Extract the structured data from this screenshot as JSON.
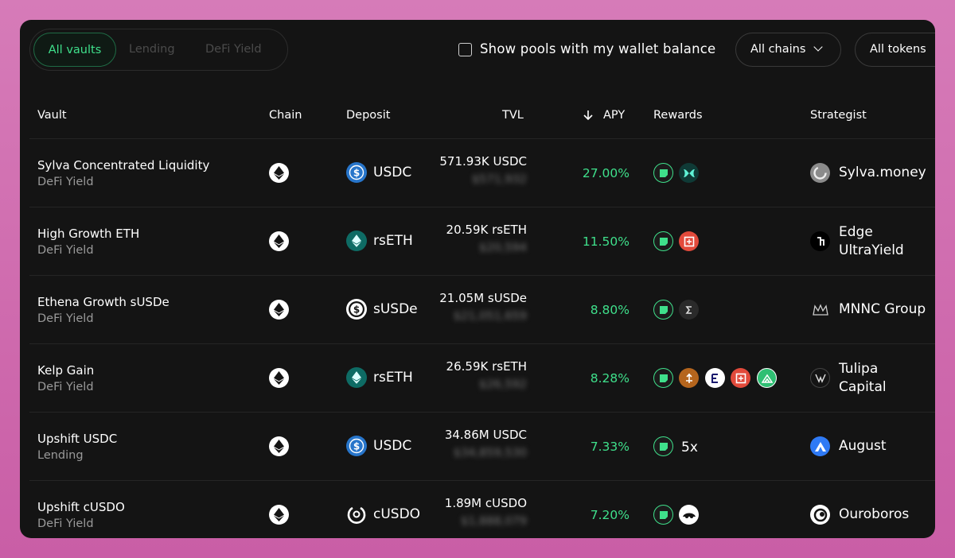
{
  "filters": {
    "tabs": [
      {
        "label": "All vaults",
        "active": true
      },
      {
        "label": "Lending",
        "active": false
      },
      {
        "label": "DeFi Yield",
        "active": false
      }
    ],
    "wallet_checkbox_label": "Show pools with my wallet balance",
    "wallet_checkbox_checked": false,
    "chains_dropdown": "All chains",
    "tokens_dropdown": "All tokens"
  },
  "table": {
    "headers": {
      "vault": "Vault",
      "chain": "Chain",
      "deposit": "Deposit",
      "tvl": "TVL",
      "apy": "APY",
      "rewards": "Rewards",
      "strategist": "Strategist"
    },
    "sort": {
      "column": "APY",
      "direction": "desc",
      "icon": "arrow-down-icon"
    },
    "rows": [
      {
        "name": "Sylva Concentrated Liquidity",
        "type": "DeFi Yield",
        "chain_icon": "ethereum-icon",
        "token": "USDC",
        "token_icon": "usdc-icon",
        "tvl": "571.93K USDC",
        "tvl_usd": "$571,932",
        "apy": "27.00%",
        "rewards": [
          "points-icon",
          "tokens-icon"
        ],
        "strategist": "Sylva.money",
        "strategist_icon": "sylva-icon"
      },
      {
        "name": "High Growth ETH",
        "type": "DeFi Yield",
        "chain_icon": "ethereum-icon",
        "token": "rsETH",
        "token_icon": "rseth-icon",
        "tvl": "20.59K rsETH",
        "tvl_usd": "$20,594",
        "apy": "11.50%",
        "rewards": [
          "points-icon",
          "ether-fi-icon"
        ],
        "strategist": "Edge UltraYield",
        "strategist_icon": "edge-icon"
      },
      {
        "name": "Ethena Growth sUSDe",
        "type": "DeFi Yield",
        "chain_icon": "ethereum-icon",
        "token": "sUSDe",
        "token_icon": "susde-icon",
        "tvl": "21.05M sUSDe",
        "tvl_usd": "$21,051,659",
        "apy": "8.80%",
        "rewards": [
          "points-icon",
          "ethena-icon"
        ],
        "strategist": "MNNC Group",
        "strategist_icon": "mnnc-icon"
      },
      {
        "name": "Kelp Gain",
        "type": "DeFi Yield",
        "chain_icon": "ethereum-icon",
        "token": "rsETH",
        "token_icon": "rseth-icon",
        "tvl": "26.59K rsETH",
        "tvl_usd": "$26,592",
        "apy": "8.28%",
        "rewards": [
          "points-icon",
          "kelp-icon",
          "eigenlayer-icon",
          "ether-fi-icon",
          "mountain-icon"
        ],
        "strategist": "Tulipa Capital",
        "strategist_icon": "tulipa-icon"
      },
      {
        "name": "Upshift USDC",
        "type": "Lending",
        "chain_icon": "ethereum-icon",
        "token": "USDC",
        "token_icon": "usdc-icon",
        "tvl": "34.86M USDC",
        "tvl_usd": "$34,859,530",
        "apy": "7.33%",
        "rewards": [
          "points-icon"
        ],
        "rewards_multiplier": "5x",
        "strategist": "August",
        "strategist_icon": "august-icon"
      },
      {
        "name": "Upshift cUSDO",
        "type": "DeFi Yield",
        "chain_icon": "ethereum-icon",
        "token": "cUSDO",
        "token_icon": "cusdo-icon",
        "tvl": "1.89M cUSDO",
        "tvl_usd": "$1,888,079",
        "apy": "7.20%",
        "rewards": [
          "points-icon",
          "ouroboros-reward-icon"
        ],
        "strategist": "Ouroboros",
        "strategist_icon": "ouroboros-icon"
      }
    ]
  },
  "colors": {
    "accent": "#3fe08b",
    "panel": "#141414",
    "background": "#d67bb8"
  }
}
